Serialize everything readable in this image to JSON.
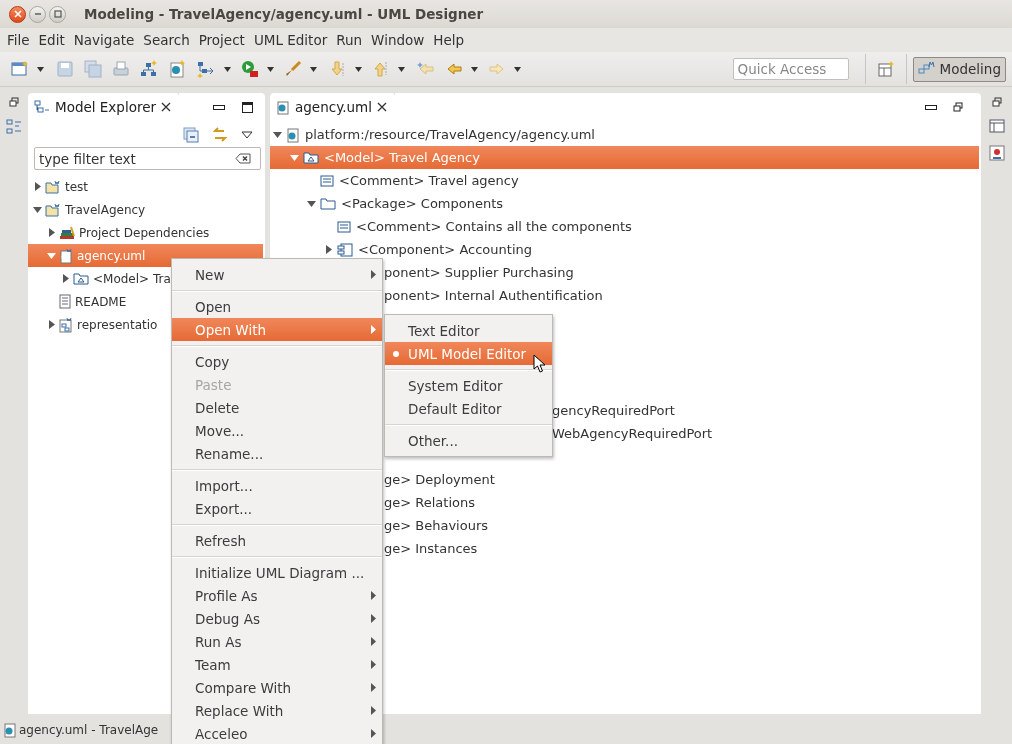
{
  "window": {
    "title": "Modeling - TravelAgency/agency.uml - UML Designer"
  },
  "menu_bar": [
    "File",
    "Edit",
    "Navigate",
    "Search",
    "Project",
    "UML Editor",
    "Run",
    "Window",
    "Help"
  ],
  "toolbar": {
    "quick_access": {
      "placeholder": "Quick Access"
    },
    "perspective": {
      "label": "Modeling",
      "selected": true
    }
  },
  "model_explorer": {
    "tab": "Model Explorer",
    "filter": {
      "placeholder": "type filter text"
    },
    "tree": [
      {
        "label": "test",
        "kind": "project",
        "expanded": false,
        "selected": false
      },
      {
        "label": "TravelAgency",
        "kind": "project",
        "expanded": true,
        "selected": false,
        "children": [
          {
            "label": "Project Dependencies",
            "kind": "library",
            "expanded": false,
            "selected": false
          },
          {
            "label": "agency.uml",
            "kind": "uml_file",
            "expanded": true,
            "selected": true,
            "children": [
              {
                "label": "<Model> Tra",
                "kind": "model",
                "expanded": false,
                "selected": false
              }
            ]
          },
          {
            "label": "README",
            "kind": "text_file",
            "selected": false
          },
          {
            "label": "representatio",
            "kind": "representations",
            "expanded": false,
            "selected": false
          }
        ]
      }
    ]
  },
  "editor": {
    "tab": "agency.uml",
    "tree": [
      {
        "label": "platform:/resource/TravelAgency/agency.uml",
        "kind": "resource",
        "expanded": true,
        "selected": false,
        "children": [
          {
            "label": "<Model> Travel Agency",
            "kind": "model",
            "expanded": true,
            "selected": true,
            "children": [
              {
                "label": "<Comment> Travel agency",
                "kind": "comment",
                "selected": false
              },
              {
                "label": "<Package> Components",
                "kind": "package",
                "expanded": true,
                "selected": false,
                "children": [
                  {
                    "label": "<Comment> Contains all the components",
                    "kind": "comment",
                    "selected": false
                  },
                  {
                    "label": "<Component> Accounting",
                    "kind": "component",
                    "expanded": false,
                    "selected": false
                  },
                  {
                    "label": "ponent> Supplier Purchasing",
                    "selected": false,
                    "covered_by_menu": true
                  },
                  {
                    "label": "ponent> Internal Authentification",
                    "selected": false,
                    "covered_by_menu": true
                  },
                  {
                    "label": "gencyRequiredPort",
                    "selected": false,
                    "covered_by_submenu": true
                  },
                  {
                    "label": "WebAgencyRequiredPort",
                    "selected": false,
                    "covered_by_submenu": true
                  }
                ]
              },
              {
                "label": "ge> Deployment",
                "selected": false,
                "covered_by_menu": true
              },
              {
                "label": "ge> Relations",
                "selected": false,
                "covered_by_menu": true
              },
              {
                "label": "ge> Behaviours",
                "selected": false,
                "covered_by_menu": true
              },
              {
                "label": "ge> Instances",
                "selected": false,
                "covered_by_menu": true
              }
            ]
          }
        ]
      }
    ]
  },
  "context_menu": {
    "items": [
      {
        "kind": "item",
        "label": "New",
        "submenu": true,
        "disabled": false,
        "selected": false
      },
      {
        "kind": "separator"
      },
      {
        "kind": "item",
        "label": "Open",
        "submenu": false,
        "disabled": false,
        "selected": false
      },
      {
        "kind": "item",
        "label": "Open With",
        "submenu": true,
        "disabled": false,
        "selected": true
      },
      {
        "kind": "separator"
      },
      {
        "kind": "item",
        "label": "Copy",
        "submenu": false,
        "disabled": false,
        "selected": false
      },
      {
        "kind": "item",
        "label": "Paste",
        "submenu": false,
        "disabled": true,
        "selected": false
      },
      {
        "kind": "item",
        "label": "Delete",
        "submenu": false,
        "disabled": false,
        "selected": false
      },
      {
        "kind": "item",
        "label": "Move...",
        "submenu": false,
        "disabled": false,
        "selected": false
      },
      {
        "kind": "item",
        "label": "Rename...",
        "submenu": false,
        "disabled": false,
        "selected": false
      },
      {
        "kind": "separator"
      },
      {
        "kind": "item",
        "label": "Import...",
        "submenu": false,
        "disabled": false,
        "selected": false
      },
      {
        "kind": "item",
        "label": "Export...",
        "submenu": false,
        "disabled": false,
        "selected": false
      },
      {
        "kind": "separator"
      },
      {
        "kind": "item",
        "label": "Refresh",
        "submenu": false,
        "disabled": false,
        "selected": false
      },
      {
        "kind": "separator"
      },
      {
        "kind": "item",
        "label": "Initialize UML Diagram ...",
        "submenu": false,
        "disabled": false,
        "selected": false
      },
      {
        "kind": "item",
        "label": "Profile As",
        "submenu": true,
        "disabled": false,
        "selected": false
      },
      {
        "kind": "item",
        "label": "Debug As",
        "submenu": true,
        "disabled": false,
        "selected": false
      },
      {
        "kind": "item",
        "label": "Run As",
        "submenu": true,
        "disabled": false,
        "selected": false
      },
      {
        "kind": "item",
        "label": "Team",
        "submenu": true,
        "disabled": false,
        "selected": false
      },
      {
        "kind": "item",
        "label": "Compare With",
        "submenu": true,
        "disabled": false,
        "selected": false
      },
      {
        "kind": "item",
        "label": "Replace With",
        "submenu": true,
        "disabled": false,
        "selected": false
      },
      {
        "kind": "item",
        "label": "Acceleo",
        "submenu": true,
        "disabled": false,
        "selected": false
      }
    ]
  },
  "open_with_menu": {
    "items": [
      {
        "kind": "item",
        "label": "Text Editor",
        "checked": false,
        "selected": false
      },
      {
        "kind": "item",
        "label": "UML Model Editor",
        "checked": true,
        "selected": true
      },
      {
        "kind": "separator"
      },
      {
        "kind": "item",
        "label": "System Editor",
        "checked": false,
        "selected": false
      },
      {
        "kind": "item",
        "label": "Default Editor",
        "checked": false,
        "selected": false
      },
      {
        "kind": "separator"
      },
      {
        "kind": "item",
        "label": "Other...",
        "checked": false,
        "selected": false
      }
    ]
  },
  "status_bar": {
    "text": "agency.uml - TravelAge"
  }
}
